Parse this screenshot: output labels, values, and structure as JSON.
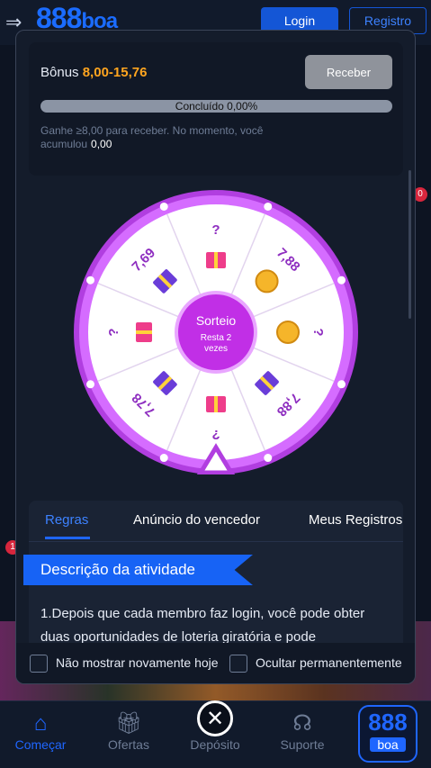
{
  "background": {
    "logo": "888",
    "logo_suffix": "boa",
    "login_label": "Login",
    "register_label": "Registro",
    "badge_count": "1",
    "badge_count_right": "0"
  },
  "bonus": {
    "label": "Bônus",
    "value": "8,00-15,76",
    "receive_label": "Receber",
    "progress_text": "Concluído 0,00%",
    "progress_percent": 0,
    "hint_text": "Ganhe ≥8,00 para receber. No momento, você acumulou",
    "accumulated": "0,00"
  },
  "wheel": {
    "center_title": "Sorteio",
    "center_sub_1": "Resta  2",
    "center_sub_2": "vezes",
    "segments": [
      {
        "label": "?",
        "icon": "gift-icon"
      },
      {
        "label": "7,88",
        "icon": "coin-icon"
      },
      {
        "label": "?",
        "icon": "coin-icon"
      },
      {
        "label": "7,88",
        "icon": "gift-icon"
      },
      {
        "label": "?",
        "icon": "gift-icon"
      },
      {
        "label": "7,78",
        "icon": "gift-icon"
      },
      {
        "label": "?",
        "icon": "gift-icon"
      },
      {
        "label": "7,69",
        "icon": "gift-icon"
      }
    ],
    "colors": {
      "rim": "#b13ee0",
      "rim_light": "#d56cff",
      "center": "#c12fe6",
      "label": "#8e2ec0"
    }
  },
  "tabs": {
    "items": [
      "Regras",
      "Anúncio do vencedor",
      "Meus Registros"
    ]
  },
  "rules": {
    "banner": "Descrição da atividade",
    "text": "1.Depois que cada membro faz login, você pode obter duas oportunidades de loteria giratória e pode"
  },
  "footer": {
    "option1": "Não mostrar novamente hoje",
    "option2": "Ocultar permanentemente"
  },
  "bottom_nav": {
    "items": [
      {
        "label": "Começar",
        "icon": "home-icon"
      },
      {
        "label": "Ofertas",
        "icon": "gift-box-icon"
      },
      {
        "label": "Depósito",
        "icon": "wallet-icon"
      },
      {
        "label": "Suporte",
        "icon": "headset-icon"
      }
    ],
    "logo_top": "888",
    "logo_bottom": "boa",
    "close_glyph": "✕"
  }
}
